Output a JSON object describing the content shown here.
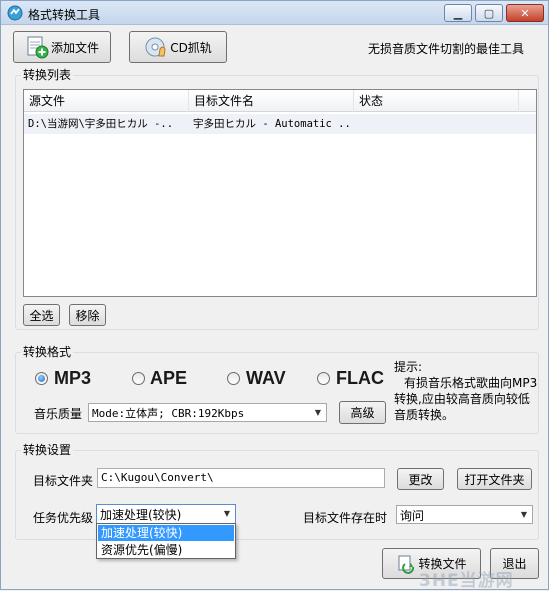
{
  "window": {
    "title": "格式转换工具",
    "min_label": "▁",
    "max_label": "▢",
    "close_label": "✕"
  },
  "toolbar": {
    "add_file_label": "添加文件",
    "cd_rip_label": "CD抓轨",
    "slogan": "无损音质文件切割的最佳工具"
  },
  "convert_list": {
    "group_label": "转换列表",
    "columns": [
      "源文件",
      "目标文件名",
      "状态"
    ],
    "rows": [
      {
        "source": "D:\\当游网\\宇多田ヒカル -..",
        "target": "宇多田ヒカル - Automatic ..",
        "status": ""
      }
    ],
    "select_all_label": "全选",
    "remove_label": "移除"
  },
  "format": {
    "group_label": "转换格式",
    "options": [
      {
        "label": "MP3",
        "checked": true
      },
      {
        "label": "APE",
        "checked": false
      },
      {
        "label": "WAV",
        "checked": false
      },
      {
        "label": "FLAC",
        "checked": false
      }
    ],
    "quality_label": "音乐质量",
    "quality_value": "Mode:立体声; CBR:192Kbps",
    "advanced_label": "高级",
    "hint_title": "提示:",
    "hint_lines": [
      "有损音乐格式歌曲向MP3",
      "转换,应由较高音质向较低",
      "音质转换。"
    ]
  },
  "settings": {
    "group_label": "转换设置",
    "target_folder_label": "目标文件夹",
    "target_folder_value": "C:\\Kugou\\Convert\\",
    "change_label": "更改",
    "open_folder_label": "打开文件夹",
    "priority_label": "任务优先级",
    "priority_value": "加速处理(较快)",
    "priority_options": [
      "加速处理(较快)",
      "资源优先(偏慢)"
    ],
    "exists_label": "目标文件存在时",
    "exists_value": "询问"
  },
  "footer": {
    "convert_label": "转换文件",
    "exit_label": "退出"
  },
  "watermark": "3HE当游网",
  "colors": {
    "accent": "#3399ff",
    "radio_fill": "#1a68c9"
  }
}
